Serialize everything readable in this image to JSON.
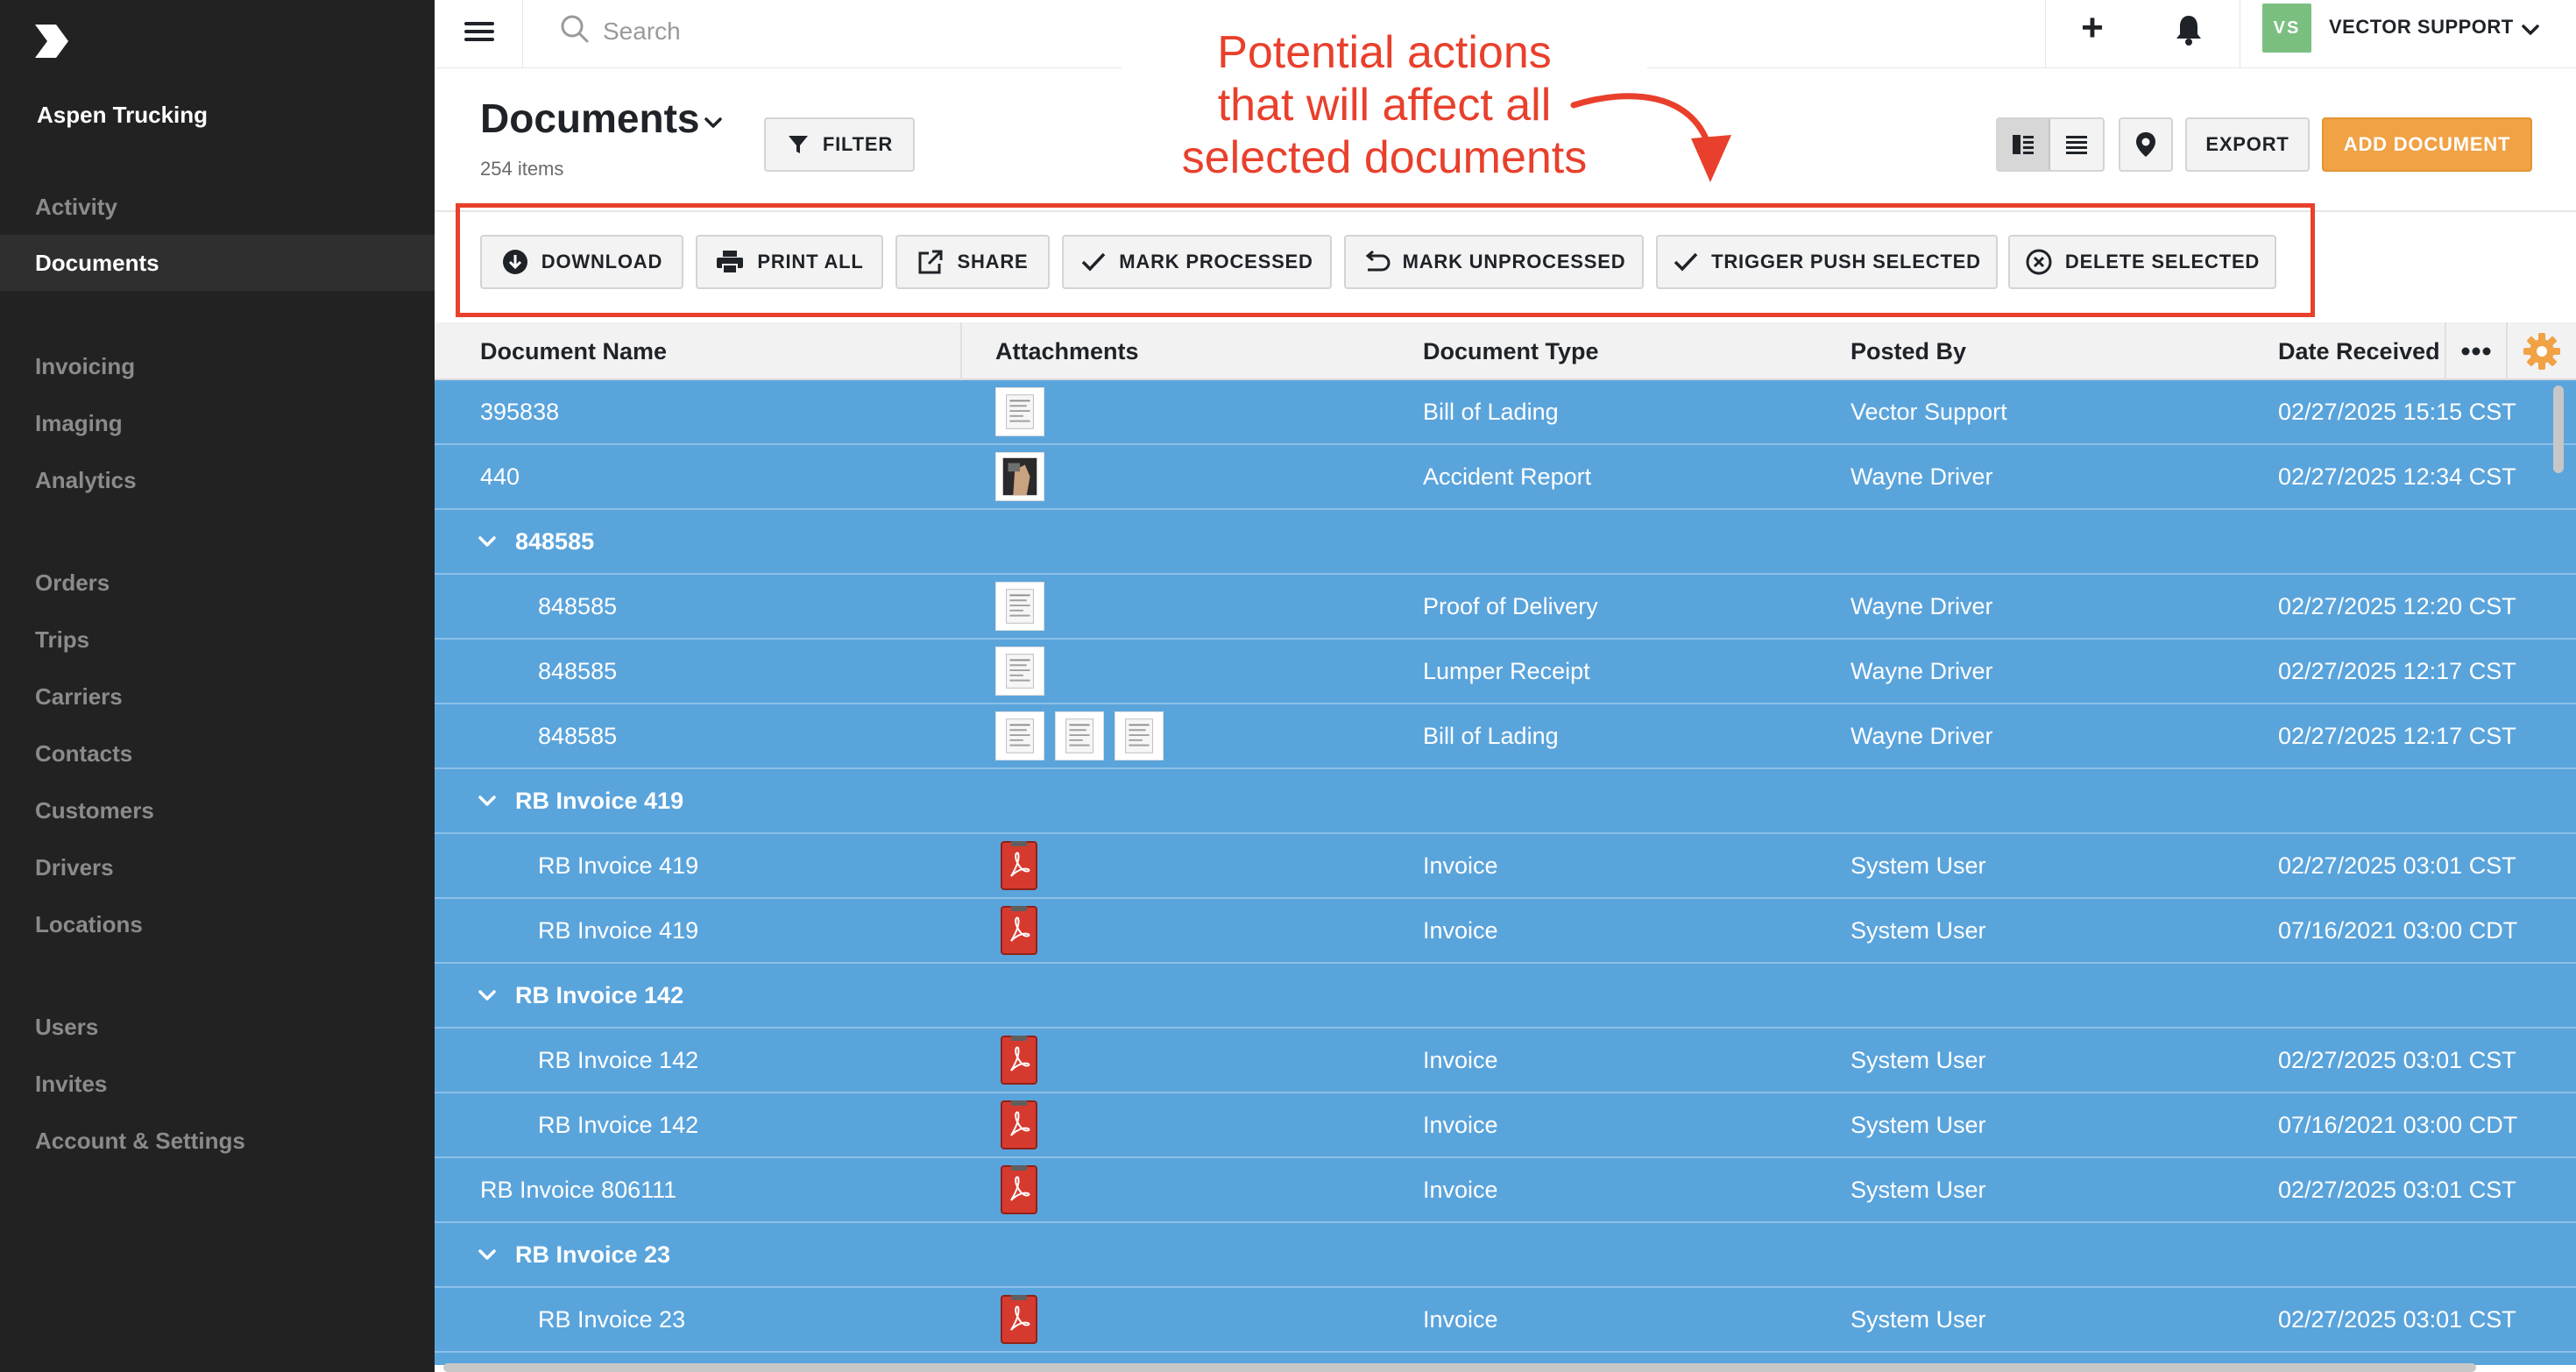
{
  "sidebar": {
    "org_name": "Aspen Trucking",
    "items": [
      {
        "label": "Activity"
      },
      {
        "label": "Documents",
        "active": true
      },
      {
        "label": "Invoicing"
      },
      {
        "label": "Imaging"
      },
      {
        "label": "Analytics"
      },
      {
        "label": "Orders"
      },
      {
        "label": "Trips"
      },
      {
        "label": "Carriers"
      },
      {
        "label": "Contacts"
      },
      {
        "label": "Customers"
      },
      {
        "label": "Drivers"
      },
      {
        "label": "Locations"
      },
      {
        "label": "Users"
      },
      {
        "label": "Invites"
      },
      {
        "label": "Account & Settings"
      }
    ]
  },
  "topbar": {
    "search_placeholder": "Search",
    "avatar_initials": "VS",
    "user_name": "VECTOR SUPPORT"
  },
  "page": {
    "title": "Documents",
    "item_count": "254 items",
    "filter_label": "FILTER",
    "export_label": "EXPORT",
    "add_label": "ADD DOCUMENT"
  },
  "annotation": {
    "line1": "Potential actions",
    "line2": "that will affect all",
    "line3": "selected documents"
  },
  "actions": {
    "download": "DOWNLOAD",
    "print_all": "PRINT ALL",
    "share": "SHARE",
    "mark_processed": "MARK PROCESSED",
    "mark_unprocessed": "MARK UNPROCESSED",
    "trigger_push": "TRIGGER PUSH SELECTED",
    "delete_selected": "DELETE SELECTED"
  },
  "table": {
    "columns": {
      "name": "Document Name",
      "attachments": "Attachments",
      "type": "Document Type",
      "posted_by": "Posted By",
      "date_received": "Date Received"
    },
    "rows": [
      {
        "kind": "doc",
        "name": "395838",
        "thumbs": [
          "doc"
        ],
        "type": "Bill of Lading",
        "posted_by": "Vector Support",
        "date": "02/27/2025 15:15 CST"
      },
      {
        "kind": "doc",
        "name": "440",
        "thumbs": [
          "photo"
        ],
        "type": "Accident Report",
        "posted_by": "Wayne Driver",
        "date": "02/27/2025 12:34 CST"
      },
      {
        "kind": "group",
        "name": "848585"
      },
      {
        "kind": "child",
        "name": "848585",
        "thumbs": [
          "doc"
        ],
        "type": "Proof of Delivery",
        "posted_by": "Wayne Driver",
        "date": "02/27/2025 12:20 CST"
      },
      {
        "kind": "child",
        "name": "848585",
        "thumbs": [
          "doc"
        ],
        "type": "Lumper Receipt",
        "posted_by": "Wayne Driver",
        "date": "02/27/2025 12:17 CST"
      },
      {
        "kind": "child",
        "name": "848585",
        "thumbs": [
          "doc",
          "doc",
          "doc"
        ],
        "type": "Bill of Lading",
        "posted_by": "Wayne Driver",
        "date": "02/27/2025 12:17 CST"
      },
      {
        "kind": "group",
        "name": "RB Invoice 419"
      },
      {
        "kind": "child",
        "name": "RB Invoice 419",
        "thumbs": [
          "pdf"
        ],
        "type": "Invoice",
        "posted_by": "System User",
        "date": "02/27/2025 03:01 CST"
      },
      {
        "kind": "child",
        "name": "RB Invoice 419",
        "thumbs": [
          "pdf"
        ],
        "type": "Invoice",
        "posted_by": "System User",
        "date": "07/16/2021 03:00 CDT"
      },
      {
        "kind": "group",
        "name": "RB Invoice 142"
      },
      {
        "kind": "child",
        "name": "RB Invoice 142",
        "thumbs": [
          "pdf"
        ],
        "type": "Invoice",
        "posted_by": "System User",
        "date": "02/27/2025 03:01 CST"
      },
      {
        "kind": "child",
        "name": "RB Invoice 142",
        "thumbs": [
          "pdf"
        ],
        "type": "Invoice",
        "posted_by": "System User",
        "date": "07/16/2021 03:00 CDT"
      },
      {
        "kind": "doc",
        "name": "RB Invoice 806111",
        "thumbs": [
          "pdf"
        ],
        "type": "Invoice",
        "posted_by": "System User",
        "date": "02/27/2025 03:01 CST"
      },
      {
        "kind": "group",
        "name": "RB Invoice 23"
      },
      {
        "kind": "child",
        "name": "RB Invoice 23",
        "thumbs": [
          "pdf"
        ],
        "type": "Invoice",
        "posted_by": "System User",
        "date": "02/27/2025 03:01 CST"
      }
    ]
  },
  "colors": {
    "sidebar_bg": "#222222",
    "selected_row": "#5aa4dc",
    "accent_orange": "#f0a245",
    "annotation_red": "#e8402c",
    "avatar_green": "#7bbf80"
  }
}
